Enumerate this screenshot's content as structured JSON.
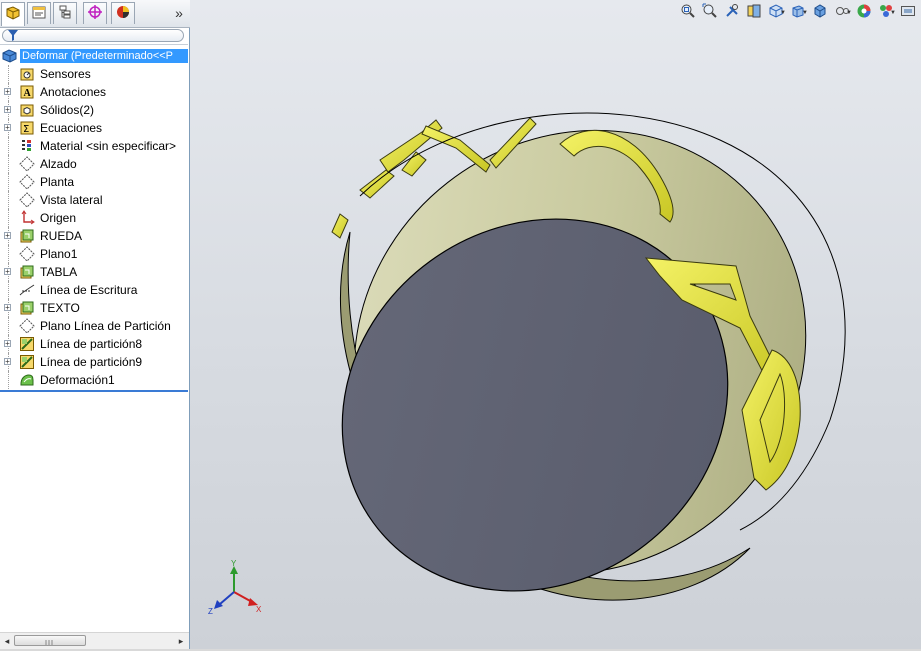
{
  "feature_tree": {
    "root_label": "Deformar  (Predeterminado<<P",
    "items": [
      {
        "label": "Sensores",
        "icon": "sensors-icon",
        "expandable": false
      },
      {
        "label": "Anotaciones",
        "icon": "annotations-icon",
        "expandable": true
      },
      {
        "label": "Sólidos(2)",
        "icon": "solid-bodies-folder-icon",
        "expandable": true
      },
      {
        "label": "Ecuaciones",
        "icon": "equations-icon",
        "expandable": true
      },
      {
        "label": "Material <sin especificar>",
        "icon": "material-icon",
        "expandable": false
      },
      {
        "label": "Alzado",
        "icon": "plane-icon",
        "expandable": false
      },
      {
        "label": "Planta",
        "icon": "plane-icon",
        "expandable": false
      },
      {
        "label": "Vista lateral",
        "icon": "plane-icon",
        "expandable": false
      },
      {
        "label": "Origen",
        "icon": "origin-icon",
        "expandable": false
      },
      {
        "label": "RUEDA",
        "icon": "extrude-feature-icon",
        "expandable": true
      },
      {
        "label": "Plano1",
        "icon": "plane-icon",
        "expandable": false
      },
      {
        "label": "TABLA",
        "icon": "extrude-feature-icon",
        "expandable": true
      },
      {
        "label": "Línea de Escritura",
        "icon": "sketch-icon",
        "expandable": false
      },
      {
        "label": "TEXTO",
        "icon": "extrude-feature-icon",
        "expandable": true
      },
      {
        "label": "Plano Línea de Partición",
        "icon": "plane-icon",
        "expandable": false
      },
      {
        "label": "Línea de partición8",
        "icon": "split-line-icon",
        "expandable": true
      },
      {
        "label": "Línea de partición9",
        "icon": "split-line-icon",
        "expandable": true
      },
      {
        "label": "Deformación1",
        "icon": "deform-feature-icon",
        "expandable": false
      }
    ]
  },
  "panel_tabs": [
    {
      "name": "featuremanager-tab",
      "icon": "feature-tree-icon"
    },
    {
      "name": "propertymanager-tab",
      "icon": "property-manager-icon"
    },
    {
      "name": "configurationmanager-tab",
      "icon": "configuration-icon"
    },
    {
      "name": "dimxpert-tab",
      "icon": "dimxpert-icon"
    },
    {
      "name": "display-manager-tab",
      "icon": "display-manager-icon"
    }
  ],
  "heads_up_toolbar": [
    "zoom-to-fit-icon",
    "zoom-to-area-icon",
    "previous-view-icon",
    "section-view-icon",
    "view-orientation-icon",
    "display-style-icon",
    "hide-show-items-icon",
    "edit-appearance-icon",
    "apply-scene-icon",
    "view-settings-icon",
    "screen-capture-icon"
  ],
  "triad": {
    "x_label": "X",
    "y_label": "Y",
    "z_label": "Z"
  },
  "colors": {
    "selection": "#3399ff",
    "viewport_bg": "#d7dbe1",
    "face_dark": "#5d6070",
    "body_metal": "#c2c39a",
    "text_yellow": "#e2e040"
  },
  "model": {
    "embossed_text": "CAD"
  }
}
